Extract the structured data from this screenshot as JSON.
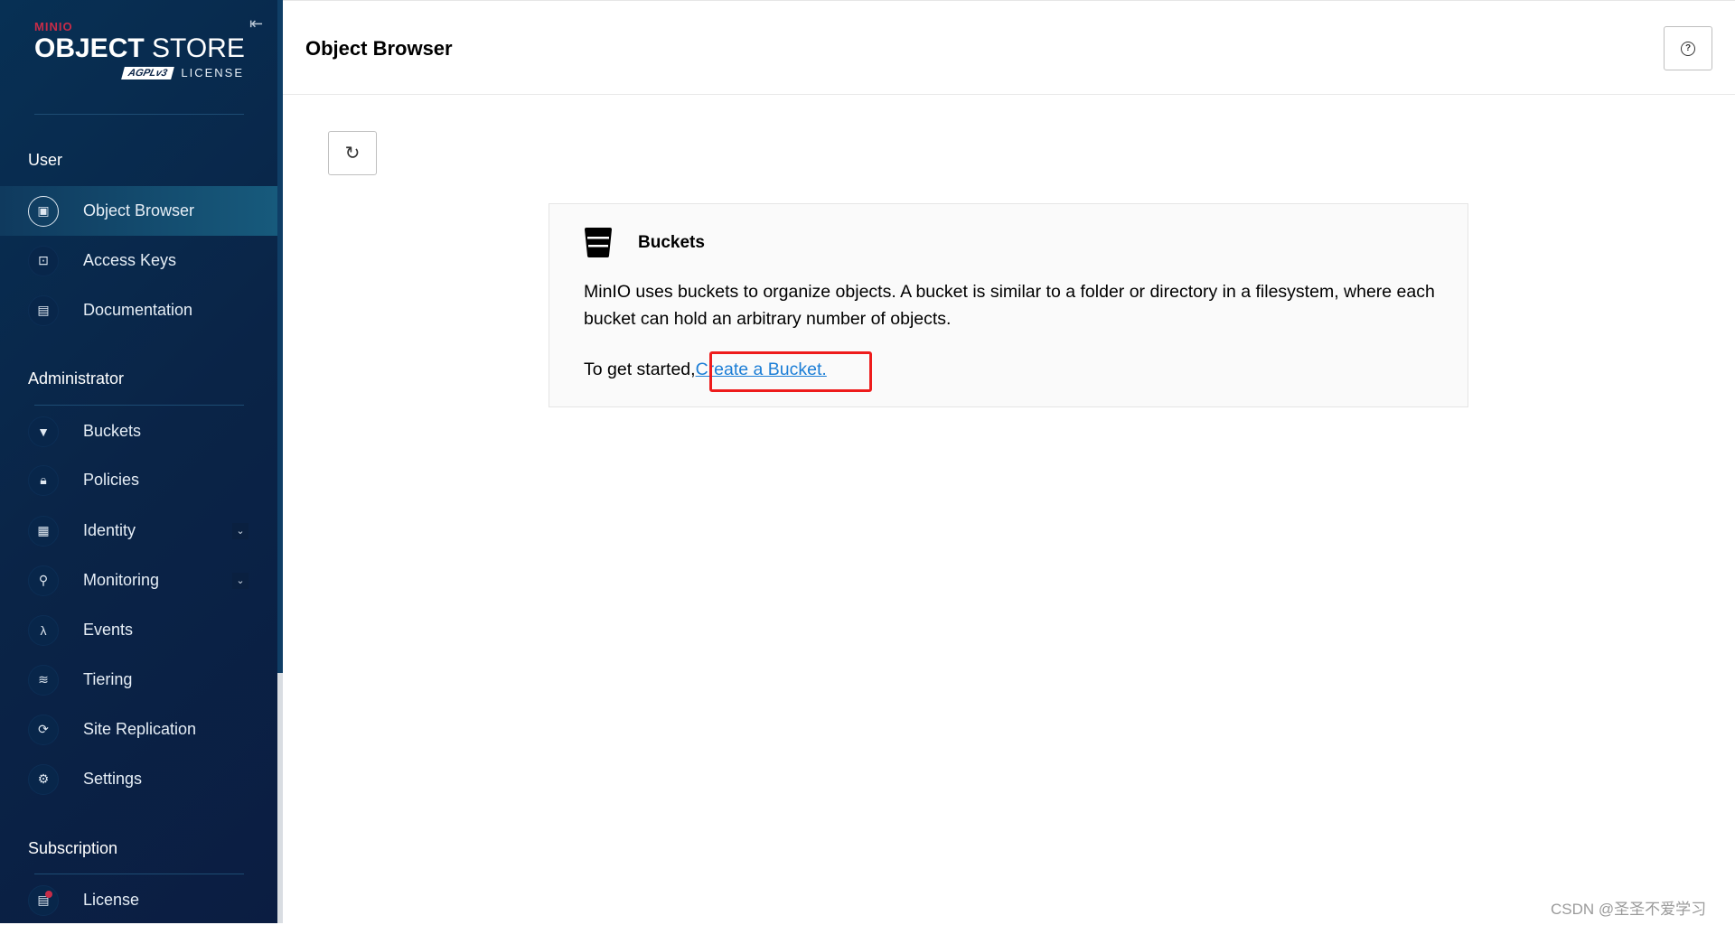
{
  "sidebar": {
    "logo": {
      "brand": "MINIO",
      "product_bold": "OBJECT",
      "product_light": "STORE",
      "badge": "AGPLv3",
      "license": "LICENSE"
    },
    "sections": [
      {
        "title": "User",
        "items": [
          {
            "label": "Object Browser",
            "icon": "object-browser-icon",
            "active": true
          },
          {
            "label": "Access Keys",
            "icon": "key-icon"
          },
          {
            "label": "Documentation",
            "icon": "document-icon"
          }
        ]
      },
      {
        "title": "Administrator",
        "items": [
          {
            "label": "Buckets",
            "icon": "bucket-icon"
          },
          {
            "label": "Policies",
            "icon": "lock-icon"
          },
          {
            "label": "Identity",
            "icon": "id-card-icon",
            "expandable": true
          },
          {
            "label": "Monitoring",
            "icon": "monitoring-icon",
            "expandable": true
          },
          {
            "label": "Events",
            "icon": "lambda-icon"
          },
          {
            "label": "Tiering",
            "icon": "layers-icon"
          },
          {
            "label": "Site Replication",
            "icon": "replication-icon"
          },
          {
            "label": "Settings",
            "icon": "gear-icon"
          }
        ]
      },
      {
        "title": "Subscription",
        "items": [
          {
            "label": "License",
            "icon": "license-icon"
          }
        ]
      }
    ]
  },
  "header": {
    "title": "Object Browser"
  },
  "card": {
    "title": "Buckets",
    "description": "MinIO uses buckets to organize objects. A bucket is similar to a folder or directory in a filesystem, where each bucket can hold an arbitrary number of objects.",
    "start_prefix": "To get started,",
    "link": "Create a Bucket."
  },
  "watermark": "CSDN @圣圣不爱学习",
  "colors": {
    "sidebar": "#0a2447",
    "active": "#175a7c",
    "link": "#1c7ed6",
    "highlight": "#ee1c1c",
    "brand": "#c72c48"
  }
}
